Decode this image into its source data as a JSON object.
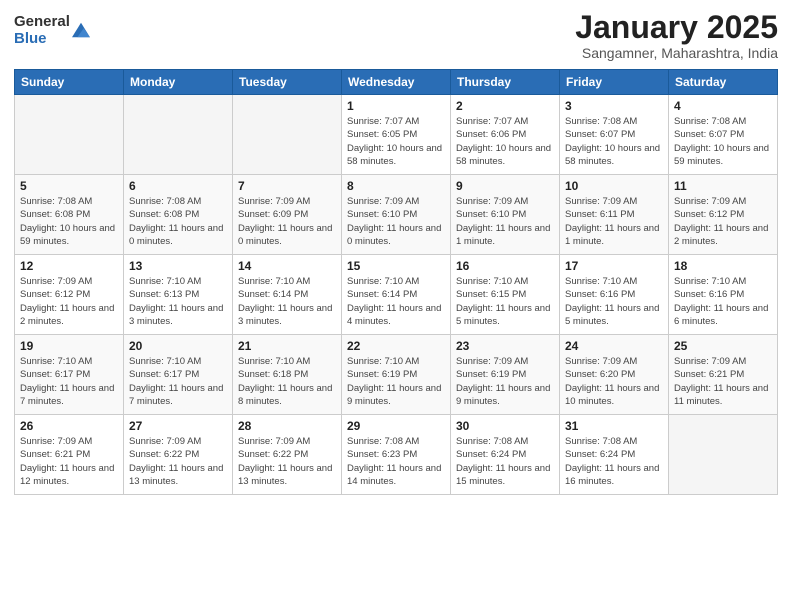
{
  "header": {
    "logo_general": "General",
    "logo_blue": "Blue",
    "month_title": "January 2025",
    "location": "Sangamner, Maharashtra, India"
  },
  "weekdays": [
    "Sunday",
    "Monday",
    "Tuesday",
    "Wednesday",
    "Thursday",
    "Friday",
    "Saturday"
  ],
  "weeks": [
    [
      {
        "day": "",
        "empty": true
      },
      {
        "day": "",
        "empty": true
      },
      {
        "day": "",
        "empty": true
      },
      {
        "day": "1",
        "sunrise": "7:07 AM",
        "sunset": "6:05 PM",
        "daylight": "10 hours and 58 minutes."
      },
      {
        "day": "2",
        "sunrise": "7:07 AM",
        "sunset": "6:06 PM",
        "daylight": "10 hours and 58 minutes."
      },
      {
        "day": "3",
        "sunrise": "7:08 AM",
        "sunset": "6:07 PM",
        "daylight": "10 hours and 58 minutes."
      },
      {
        "day": "4",
        "sunrise": "7:08 AM",
        "sunset": "6:07 PM",
        "daylight": "10 hours and 59 minutes."
      }
    ],
    [
      {
        "day": "5",
        "sunrise": "7:08 AM",
        "sunset": "6:08 PM",
        "daylight": "10 hours and 59 minutes."
      },
      {
        "day": "6",
        "sunrise": "7:08 AM",
        "sunset": "6:08 PM",
        "daylight": "11 hours and 0 minutes."
      },
      {
        "day": "7",
        "sunrise": "7:09 AM",
        "sunset": "6:09 PM",
        "daylight": "11 hours and 0 minutes."
      },
      {
        "day": "8",
        "sunrise": "7:09 AM",
        "sunset": "6:10 PM",
        "daylight": "11 hours and 0 minutes."
      },
      {
        "day": "9",
        "sunrise": "7:09 AM",
        "sunset": "6:10 PM",
        "daylight": "11 hours and 1 minute."
      },
      {
        "day": "10",
        "sunrise": "7:09 AM",
        "sunset": "6:11 PM",
        "daylight": "11 hours and 1 minute."
      },
      {
        "day": "11",
        "sunrise": "7:09 AM",
        "sunset": "6:12 PM",
        "daylight": "11 hours and 2 minutes."
      }
    ],
    [
      {
        "day": "12",
        "sunrise": "7:09 AM",
        "sunset": "6:12 PM",
        "daylight": "11 hours and 2 minutes."
      },
      {
        "day": "13",
        "sunrise": "7:10 AM",
        "sunset": "6:13 PM",
        "daylight": "11 hours and 3 minutes."
      },
      {
        "day": "14",
        "sunrise": "7:10 AM",
        "sunset": "6:14 PM",
        "daylight": "11 hours and 3 minutes."
      },
      {
        "day": "15",
        "sunrise": "7:10 AM",
        "sunset": "6:14 PM",
        "daylight": "11 hours and 4 minutes."
      },
      {
        "day": "16",
        "sunrise": "7:10 AM",
        "sunset": "6:15 PM",
        "daylight": "11 hours and 5 minutes."
      },
      {
        "day": "17",
        "sunrise": "7:10 AM",
        "sunset": "6:16 PM",
        "daylight": "11 hours and 5 minutes."
      },
      {
        "day": "18",
        "sunrise": "7:10 AM",
        "sunset": "6:16 PM",
        "daylight": "11 hours and 6 minutes."
      }
    ],
    [
      {
        "day": "19",
        "sunrise": "7:10 AM",
        "sunset": "6:17 PM",
        "daylight": "11 hours and 7 minutes."
      },
      {
        "day": "20",
        "sunrise": "7:10 AM",
        "sunset": "6:17 PM",
        "daylight": "11 hours and 7 minutes."
      },
      {
        "day": "21",
        "sunrise": "7:10 AM",
        "sunset": "6:18 PM",
        "daylight": "11 hours and 8 minutes."
      },
      {
        "day": "22",
        "sunrise": "7:10 AM",
        "sunset": "6:19 PM",
        "daylight": "11 hours and 9 minutes."
      },
      {
        "day": "23",
        "sunrise": "7:09 AM",
        "sunset": "6:19 PM",
        "daylight": "11 hours and 9 minutes."
      },
      {
        "day": "24",
        "sunrise": "7:09 AM",
        "sunset": "6:20 PM",
        "daylight": "11 hours and 10 minutes."
      },
      {
        "day": "25",
        "sunrise": "7:09 AM",
        "sunset": "6:21 PM",
        "daylight": "11 hours and 11 minutes."
      }
    ],
    [
      {
        "day": "26",
        "sunrise": "7:09 AM",
        "sunset": "6:21 PM",
        "daylight": "11 hours and 12 minutes."
      },
      {
        "day": "27",
        "sunrise": "7:09 AM",
        "sunset": "6:22 PM",
        "daylight": "11 hours and 13 minutes."
      },
      {
        "day": "28",
        "sunrise": "7:09 AM",
        "sunset": "6:22 PM",
        "daylight": "11 hours and 13 minutes."
      },
      {
        "day": "29",
        "sunrise": "7:08 AM",
        "sunset": "6:23 PM",
        "daylight": "11 hours and 14 minutes."
      },
      {
        "day": "30",
        "sunrise": "7:08 AM",
        "sunset": "6:24 PM",
        "daylight": "11 hours and 15 minutes."
      },
      {
        "day": "31",
        "sunrise": "7:08 AM",
        "sunset": "6:24 PM",
        "daylight": "11 hours and 16 minutes."
      },
      {
        "day": "",
        "empty": true
      }
    ]
  ]
}
